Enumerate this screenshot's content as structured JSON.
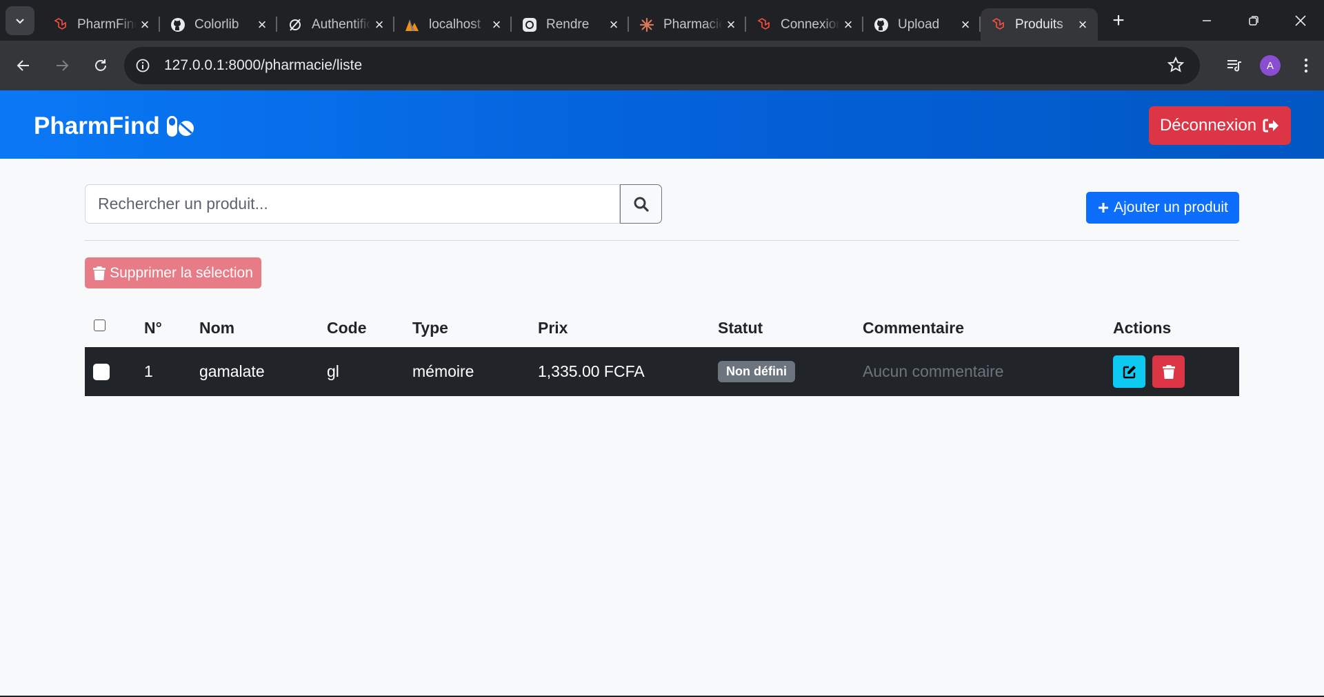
{
  "browser": {
    "tabs": [
      {
        "title": "PharmFind",
        "icon": "laravel-icon",
        "active": false
      },
      {
        "title": "Colorlib",
        "icon": "github-icon",
        "active": false
      },
      {
        "title": "Authentification",
        "icon": "leaf-icon",
        "active": false
      },
      {
        "title": "localhost",
        "icon": "phpmyadmin-icon",
        "active": false
      },
      {
        "title": "Rendre",
        "icon": "rendre-icon",
        "active": false
      },
      {
        "title": "Pharmacie",
        "icon": "claude-icon",
        "active": false
      },
      {
        "title": "Connexion",
        "icon": "laravel-icon",
        "active": false
      },
      {
        "title": "Upload",
        "icon": "github-icon",
        "active": false
      },
      {
        "title": "Produits",
        "icon": "laravel-icon",
        "active": true
      }
    ],
    "url": "127.0.0.1:8000/pharmacie/liste",
    "profile_initial": "A"
  },
  "app": {
    "brand": "PharmFind",
    "logout_label": "Déconnexion",
    "search_placeholder": "Rechercher un produit...",
    "add_label": "Ajouter un produit",
    "delete_selection_label": "Supprimer la sélection",
    "colors": {
      "primary": "#0d6efd",
      "danger": "#dc3545",
      "info": "#0dcaf0",
      "dark": "#212529"
    }
  },
  "table": {
    "headers": {
      "num": "N°",
      "name": "Nom",
      "code": "Code",
      "type": "Type",
      "price": "Prix",
      "status": "Statut",
      "comment": "Commentaire",
      "actions": "Actions"
    },
    "rows": [
      {
        "num": "1",
        "name": "gamalate",
        "code": "gl",
        "type": "mémoire",
        "price": "1,335.00 FCFA",
        "status": "Non défini",
        "comment": "Aucun commentaire"
      }
    ]
  }
}
